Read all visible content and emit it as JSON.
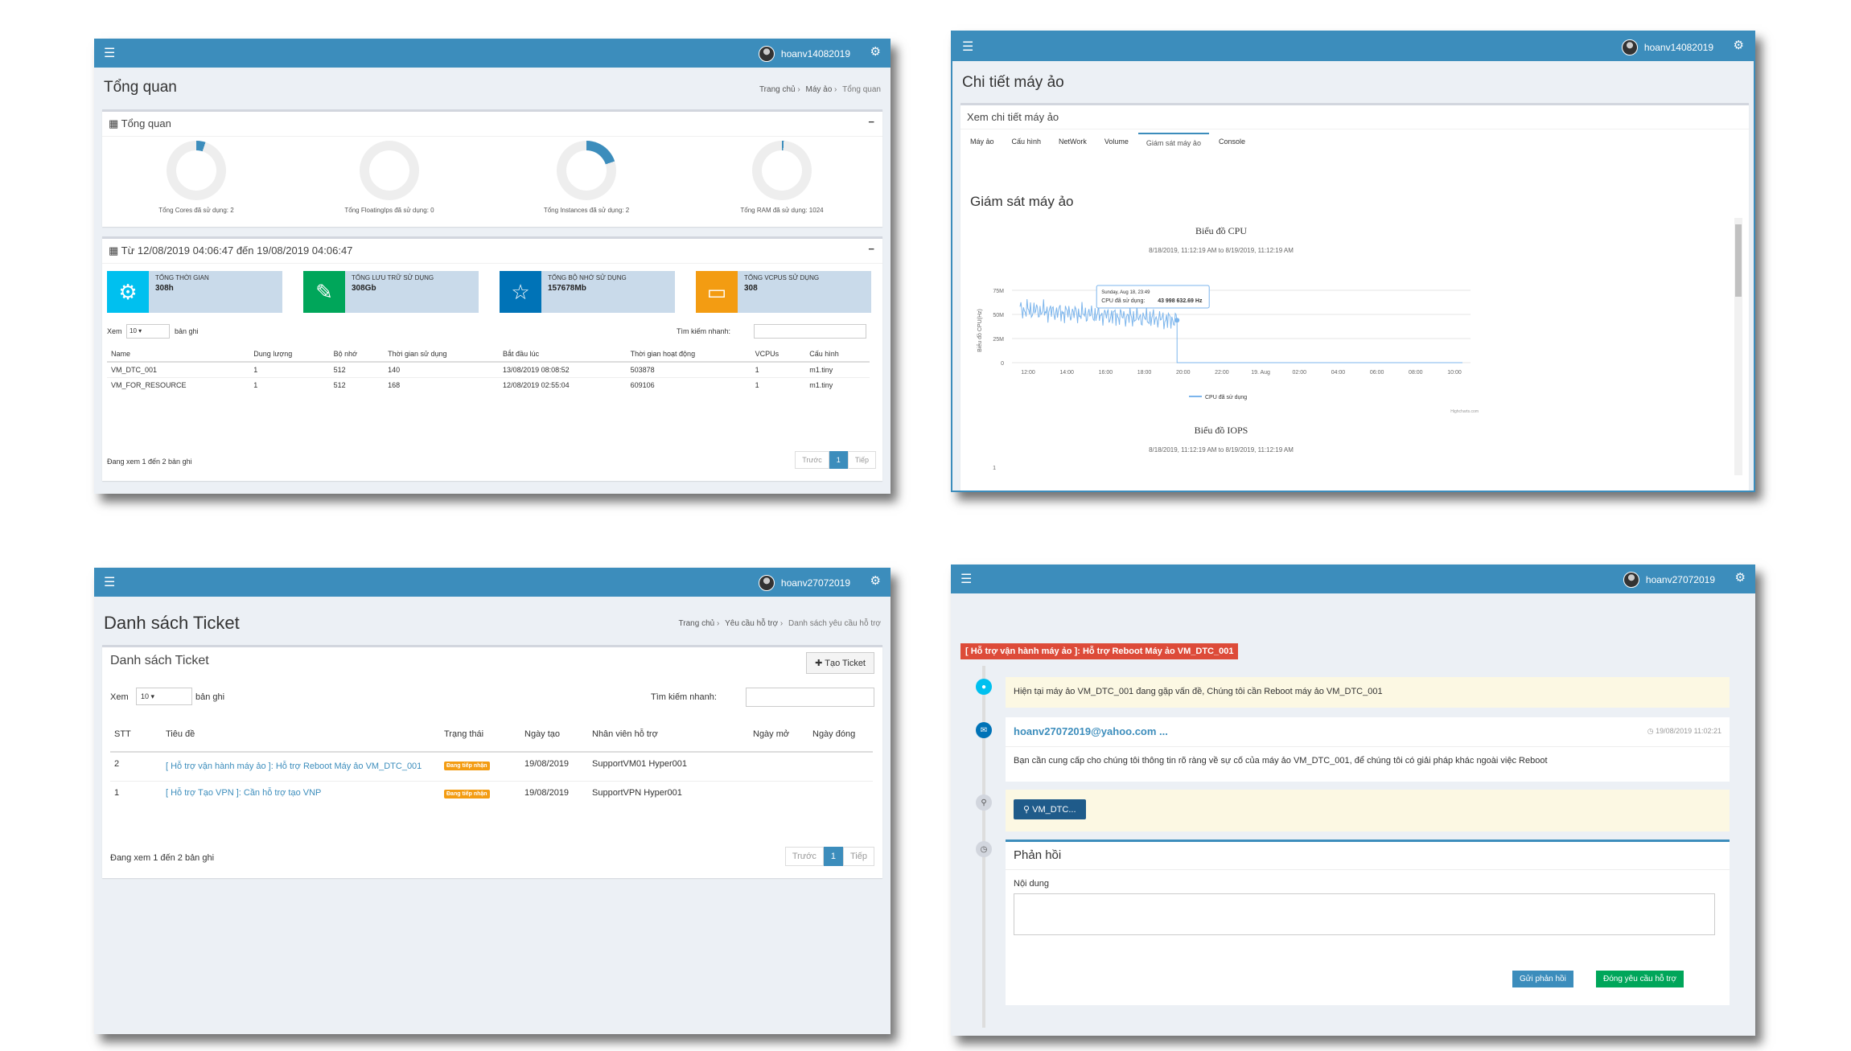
{
  "p1": {
    "user": "hoanv14082019",
    "title": "Tổng quan",
    "crumbs": [
      "Trang chủ",
      "Máy ảo",
      "Tổng quan"
    ],
    "overview_box": "Tổng quan",
    "donuts": [
      {
        "label": "Tổng Cores đã sử dụng: 2",
        "fraction": 0.05
      },
      {
        "label": "Tổng FloatingIps đã sử dụng: 0",
        "fraction": 0
      },
      {
        "label": "Tổng Instances đã sử dụng: 2",
        "fraction": 0.2
      },
      {
        "label": "Tổng RAM đã sử dụng: 1024",
        "fraction": 0.01
      }
    ],
    "range_box": "Từ 12/08/2019 04:06:47 đến 19/08/2019 04:06:47",
    "infos": [
      {
        "label": "Tổng thời gian",
        "value": "308h",
        "color": "#00c0ef",
        "icon": "⚙"
      },
      {
        "label": "Tổng lưu trữ sử dụng",
        "value": "308Gb",
        "color": "#00a65a",
        "icon": "✎"
      },
      {
        "label": "Tổng bộ nhớ sử dụng",
        "value": "157678Mb",
        "color": "#0073b7",
        "icon": "☆"
      },
      {
        "label": "Tổng VCPUs sử dụng",
        "value": "308",
        "color": "#f39c12",
        "icon": "▭"
      }
    ],
    "show_prefix": "Xem",
    "show_value": "10",
    "show_suffix": "bản ghi",
    "search_label": "Tìm kiếm nhanh:",
    "headers": [
      "Name",
      "Dung lượng",
      "Bộ nhớ",
      "Thời gian sử dụng",
      "Bắt đầu lúc",
      "Thời gian hoạt động",
      "VCPUs",
      "Cấu hình"
    ],
    "rows": [
      [
        "VM_DTC_001",
        "1",
        "512",
        "140",
        "13/08/2019 08:08:52",
        "503878",
        "1",
        "m1.tiny"
      ],
      [
        "VM_FOR_RESOURCE",
        "1",
        "512",
        "168",
        "12/08/2019 02:55:04",
        "609106",
        "1",
        "m1.tiny"
      ]
    ],
    "footer": "Đang xem 1 đến 2 bản ghi",
    "prev": "Trước",
    "page": "1",
    "next": "Tiếp"
  },
  "p2": {
    "user": "hoanv14082019",
    "title": "Chi tiết máy ảo",
    "subhead": "Xem chi tiết máy ảo",
    "tabs": [
      "Máy ảo",
      "Cấu hình",
      "NetWork",
      "Volume",
      "Giám sát máy ảo",
      "Console"
    ],
    "section": "Giám sát máy ảo",
    "chart_data": [
      {
        "type": "line",
        "title": "Biểu đồ CPU",
        "subtitle": "8/18/2019, 11:12:19 AM to 8/19/2019, 11:12:19 AM",
        "ylabel": "Biểu đồ CPU(Hz)",
        "xticks": [
          "12:00",
          "14:00",
          "16:00",
          "18:00",
          "20:00",
          "22:00",
          "19. Aug",
          "02:00",
          "04:00",
          "06:00",
          "08:00",
          "10:00"
        ],
        "yticks": [
          "0",
          "25M",
          "50M",
          "75M"
        ],
        "ylim": [
          0,
          75000000
        ],
        "series": [
          {
            "name": "CPU đã sử dụng",
            "color": "#7cb5ec",
            "level_start": 55000000,
            "level_end": 44000000,
            "drop_at": 0.36
          }
        ],
        "tooltip_time": "Sunday, Aug 18, 23:49",
        "tooltip_name": "CPU đã sử dụng:",
        "tooltip_value": "43 998 632.69 Hz",
        "credit": "Highcharts.com"
      },
      {
        "type": "line",
        "title": "Biểu đồ IOPS",
        "subtitle": "8/18/2019, 11:12:19 AM to 8/19/2019, 11:12:19 AM",
        "yticks": [
          "1"
        ]
      }
    ]
  },
  "p3": {
    "user": "hoanv27072019",
    "title": "Danh sách Ticket",
    "crumbs": [
      "Trang chủ",
      "Yêu cầu hỗ trợ",
      "Danh sách yêu cầu hỗ trợ"
    ],
    "box": "Danh sách Ticket",
    "create": "Tạo Ticket",
    "show_prefix": "Xem",
    "show_value": "10",
    "show_suffix": "bản ghi",
    "search_label": "Tìm kiếm nhanh:",
    "headers": [
      "STT",
      "Tiêu đề",
      "Trạng thái",
      "Ngày tạo",
      "Nhân viên hỗ trợ",
      "Ngày mở",
      "Ngày đóng"
    ],
    "rows": [
      {
        "stt": "2",
        "title": "[ Hỗ trợ vận hành máy ảo ]: Hỗ trợ Reboot Máy ảo VM_DTC_001",
        "status": "Đang tiếp nhận",
        "date": "19/08/2019",
        "staff": "SupportVM01 Hyper001"
      },
      {
        "stt": "1",
        "title": "[ Hỗ trợ Tạo VPN ]: Cần hỗ trợ tạo VNP",
        "status": "Đang tiếp nhận",
        "date": "19/08/2019",
        "staff": "SupportVPN Hyper001"
      }
    ],
    "footer": "Đang xem 1 đến 2 bản ghi",
    "prev": "Trước",
    "page": "1",
    "next": "Tiếp"
  },
  "p4": {
    "user": "hoanv27072019",
    "ticket_title": "[ Hỗ trợ vận hành máy ảo ]: Hỗ trợ Reboot Máy ảo VM_DTC_001",
    "message": "Hiện tại máy ảo VM_DTC_001 đang gặp vấn đề, Chúng tôi cần Reboot máy ảo VM_DTC_001",
    "email": "hoanv27072019@yahoo.com ...",
    "time": "19/08/2019 11:02:21",
    "reply": "Bạn cần cung cấp cho chúng tôi thông tin rõ ràng về sự cố của máy ảo VM_DTC_001, để chúng tôi có giải pháp khác ngoài việc Reboot",
    "attachment": "VM_DTC...",
    "feedback_title": "Phản hồi",
    "content_label": "Nội dung",
    "send": "Gửi phản hồi",
    "close": "Đóng yêu cầu hỗ trợ"
  }
}
